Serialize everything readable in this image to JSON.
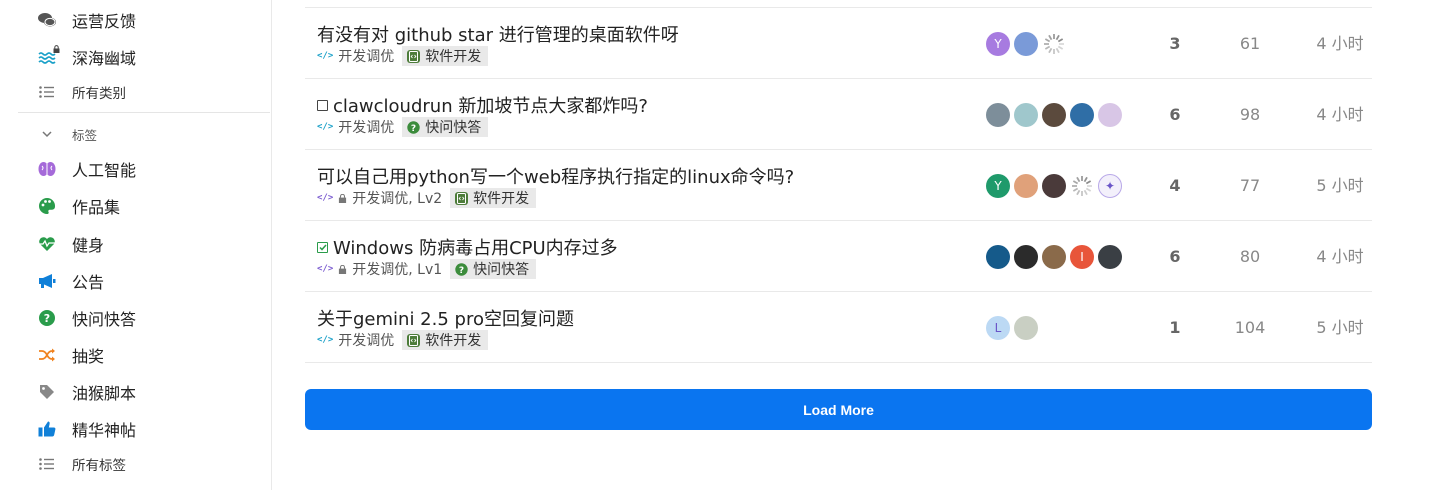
{
  "sidebar": {
    "categories": [
      {
        "label": "运营反馈",
        "icon": "comments-icon",
        "color": "#555555"
      },
      {
        "label": "深海幽域",
        "icon": "waves-icon",
        "color": "#1aa0c8",
        "locked": true
      },
      {
        "label": "所有类别",
        "icon": "list-icon",
        "color": "#666666"
      }
    ],
    "tags_header": "标签",
    "tags": [
      {
        "label": "人工智能",
        "icon": "brain-icon",
        "color": "#a56ad9"
      },
      {
        "label": "作品集",
        "icon": "palette-icon",
        "color": "#2a9c4b"
      },
      {
        "label": "健身",
        "icon": "heartbeat-icon",
        "color": "#2a9c4b"
      },
      {
        "label": "公告",
        "icon": "megaphone-icon",
        "color": "#1080d8"
      },
      {
        "label": "快问快答",
        "icon": "question-icon",
        "color": "#2a9c4b"
      },
      {
        "label": "抽奖",
        "icon": "shuffle-icon",
        "color": "#f0821e"
      },
      {
        "label": "油猴脚本",
        "icon": "tag-icon",
        "color": "#888888"
      },
      {
        "label": "精华神帖",
        "icon": "thumbs-up-icon",
        "color": "#1080d8"
      },
      {
        "label": "所有标签",
        "icon": "list-icon",
        "color": "#666666"
      }
    ]
  },
  "topics": [
    {
      "title": "有没有对 github star 进行管理的桌面软件呀",
      "status": "none",
      "category": "开发调优",
      "locked": false,
      "tag": "软件开发",
      "tag_icon": "software-dev-icon",
      "tag_color": "#4d7c3a",
      "avatars": [
        {
          "letter": "Y",
          "color": "#a77be0"
        },
        {
          "letter": "",
          "color": "#7a9ad8"
        },
        {
          "letter": "",
          "color": "spinner"
        }
      ],
      "replies": "3",
      "views": "61",
      "activity": "4 小时"
    },
    {
      "title": "clawcloudrun 新加坡节点大家都炸吗?",
      "status": "unchecked",
      "category": "开发调优",
      "locked": false,
      "tag": "快问快答",
      "tag_icon": "question-icon",
      "tag_color": "#3c8c3c",
      "avatars": [
        {
          "letter": "",
          "color": "#7d8e9a"
        },
        {
          "letter": "",
          "color": "#9fc7cc"
        },
        {
          "letter": "",
          "color": "#5b4a3d"
        },
        {
          "letter": "",
          "color": "#2f6ea6"
        },
        {
          "letter": "",
          "color": "#d8c6e6"
        }
      ],
      "replies": "6",
      "views": "98",
      "activity": "4 小时"
    },
    {
      "title": "可以自己用python写一个web程序执行指定的linux命令吗?",
      "status": "none",
      "category": "开发调优, Lv2",
      "locked": true,
      "tag": "软件开发",
      "tag_icon": "software-dev-icon",
      "tag_color": "#4d7c3a",
      "avatars": [
        {
          "letter": "Y",
          "color": "#1f9a6b"
        },
        {
          "letter": "",
          "color": "#e0a17a"
        },
        {
          "letter": "",
          "color": "#4a3a3a"
        },
        {
          "letter": "",
          "color": "spinner"
        },
        {
          "letter": "✦",
          "color": "#f3f0fb"
        }
      ],
      "replies": "4",
      "views": "77",
      "activity": "5 小时"
    },
    {
      "title": "Windows 防病毒占用CPU内存过多",
      "status": "checked",
      "category": "开发调优, Lv1",
      "locked": true,
      "tag": "快问快答",
      "tag_icon": "question-icon",
      "tag_color": "#3c8c3c",
      "avatars": [
        {
          "letter": "",
          "color": "#155a8a"
        },
        {
          "letter": "",
          "color": "#2b2b2b"
        },
        {
          "letter": "",
          "color": "#8a6a4a"
        },
        {
          "letter": "I",
          "color": "#e8553a"
        },
        {
          "letter": "",
          "color": "#3a3f44"
        }
      ],
      "replies": "6",
      "views": "80",
      "activity": "4 小时"
    },
    {
      "title": "关于gemini 2.5 pro空回复问题",
      "status": "none",
      "category": "开发调优",
      "locked": false,
      "tag": "软件开发",
      "tag_icon": "software-dev-icon",
      "tag_color": "#4d7c3a",
      "avatars": [
        {
          "letter": "L",
          "color": "#bcd9f4"
        },
        {
          "letter": "",
          "color": "#c9cfc3"
        }
      ],
      "replies": "1",
      "views": "104",
      "activity": "5 小时"
    }
  ],
  "load_more": "Load More",
  "colors": {
    "accent": "#0a75f0",
    "category_accent": "#1aa0c8"
  }
}
